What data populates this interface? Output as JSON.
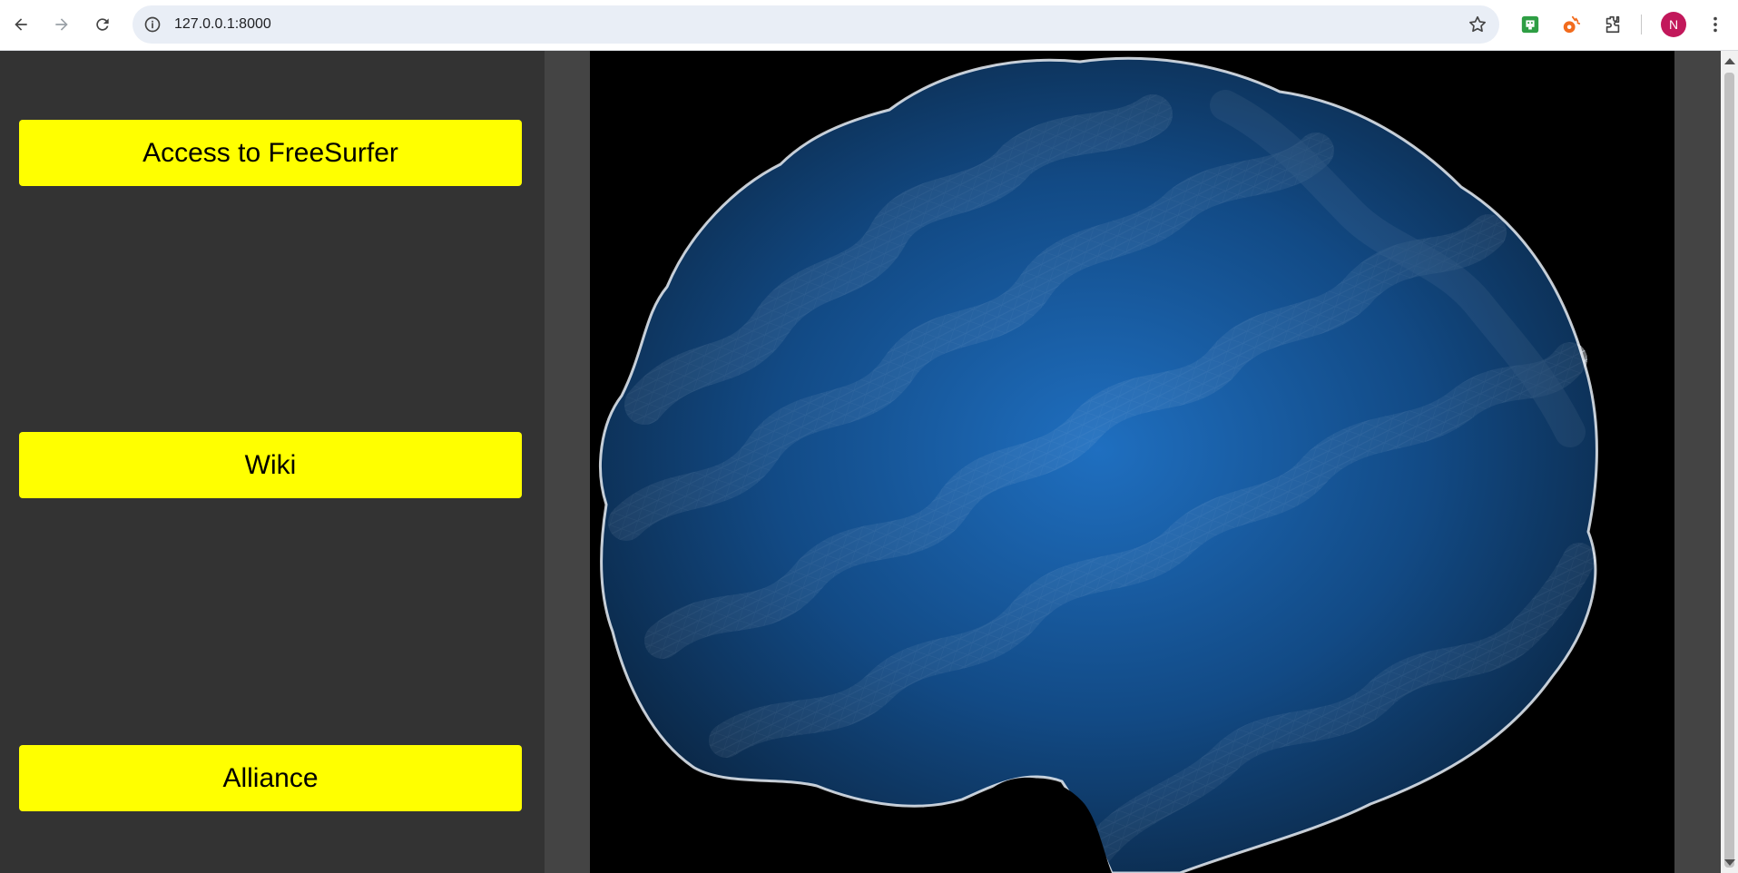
{
  "browser": {
    "url": "127.0.0.1:8000",
    "profile_initial": "N",
    "icons": {
      "back": "arrow-left-icon",
      "forward": "arrow-right-icon",
      "reload": "reload-icon",
      "site_info": "info-icon",
      "bookmark": "star-icon",
      "extension_1": "green-extension-icon",
      "extension_2": "orange-extension-icon",
      "extensions": "puzzle-icon",
      "menu": "kebab-menu-icon"
    },
    "colors": {
      "profile": "#c2185b",
      "omnibox": "#e9eef6"
    }
  },
  "sidebar": {
    "buttons": [
      {
        "label": "Access to FreeSurfer"
      },
      {
        "label": "Wiki"
      },
      {
        "label": "Alliance"
      }
    ],
    "colors": {
      "background": "#333333",
      "button": "#ffff00",
      "button_text": "#000000"
    }
  },
  "hero": {
    "image": "wireframe-brain-image",
    "colors": {
      "background": "#000000",
      "mesh_light": "#e8eef5",
      "mesh_blue": "#2f7fd0"
    }
  }
}
